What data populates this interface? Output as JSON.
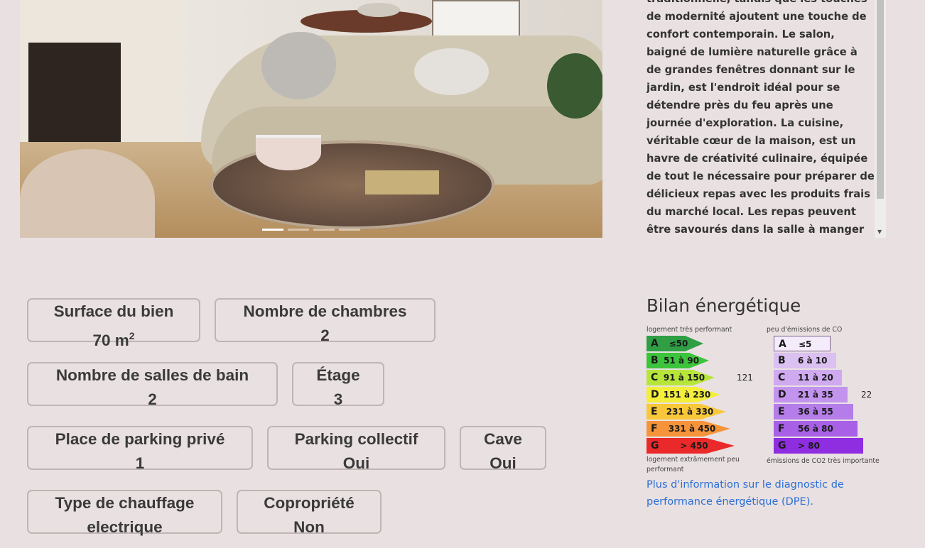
{
  "description": {
    "text": "traditionnelle, tandis que les touches de modernité ajoutent une touche de confort contemporain. Le salon, baigné de lumière naturelle grâce à de grandes fenêtres donnant sur le jardin, est l'endroit idéal pour se détendre près du feu après une journée d'exploration. La cuisine, véritable cœur de la maison, est un havre de créativité culinaire, équipée de tout le nécessaire pour préparer de délicieux repas avec les produits frais du marché local. Les repas peuvent être savourés dans la salle à manger attenante, où une grande table en bois"
  },
  "carousel": {
    "slides": 4,
    "active_index": 0
  },
  "features": {
    "surface": {
      "label": "Surface du bien",
      "value": "70 m",
      "unit_exp": "2"
    },
    "chambres": {
      "label": "Nombre de chambres",
      "value": "2"
    },
    "salles_de_bain": {
      "label": "Nombre de salles de bain",
      "value": "2"
    },
    "etage": {
      "label": "Étage",
      "value": "3"
    },
    "parking_prive": {
      "label": "Place de parking privé",
      "value": "1"
    },
    "parking_collectif": {
      "label": "Parking collectif",
      "value": "Oui"
    },
    "cave": {
      "label": "Cave",
      "value": "Oui"
    },
    "chauffage": {
      "label": "Type de chauffage",
      "value": "electrique"
    },
    "copropriete": {
      "label": "Copropriété",
      "value": "Non"
    }
  },
  "energy": {
    "title": "Bilan énergétique",
    "dpe": {
      "top_label": "logement très performant",
      "bottom_label": "logement extrâmement peu performant",
      "value": "121",
      "current_class": "C",
      "classes": [
        {
          "letter": "A",
          "range": "≤50",
          "color": "#2f9e44"
        },
        {
          "letter": "B",
          "range": "51 à 90",
          "color": "#3cc43c"
        },
        {
          "letter": "C",
          "range": "91 à 150",
          "color": "#b7e63a"
        },
        {
          "letter": "D",
          "range": "151 à 230",
          "color": "#f3ef3a"
        },
        {
          "letter": "E",
          "range": "231 à 330",
          "color": "#f8c83a"
        },
        {
          "letter": "F",
          "range": "331 à 450",
          "color": "#f5943a"
        },
        {
          "letter": "G",
          "range": "> 450",
          "color": "#ea2a2a"
        }
      ]
    },
    "ges": {
      "top_label": "peu d'émissions de CO",
      "bottom_label": "émissions de CO2 très importante",
      "value": "22",
      "current_class": "D",
      "classes": [
        {
          "letter": "A",
          "range": "≤5",
          "color": "#f4ecfb"
        },
        {
          "letter": "B",
          "range": "6 à 10",
          "color": "#dbc0f2"
        },
        {
          "letter": "C",
          "range": "11 à 20",
          "color": "#cfaaf0"
        },
        {
          "letter": "D",
          "range": "21 à 35",
          "color": "#c294ee"
        },
        {
          "letter": "E",
          "range": "36 à 55",
          "color": "#b57de9"
        },
        {
          "letter": "F",
          "range": "56 à 80",
          "color": "#a760e6"
        },
        {
          "letter": "G",
          "range": "> 80",
          "color": "#8f2de0"
        }
      ]
    },
    "link_text": "Plus d'information sur le diagnostic de performance énergétique (DPE)."
  }
}
